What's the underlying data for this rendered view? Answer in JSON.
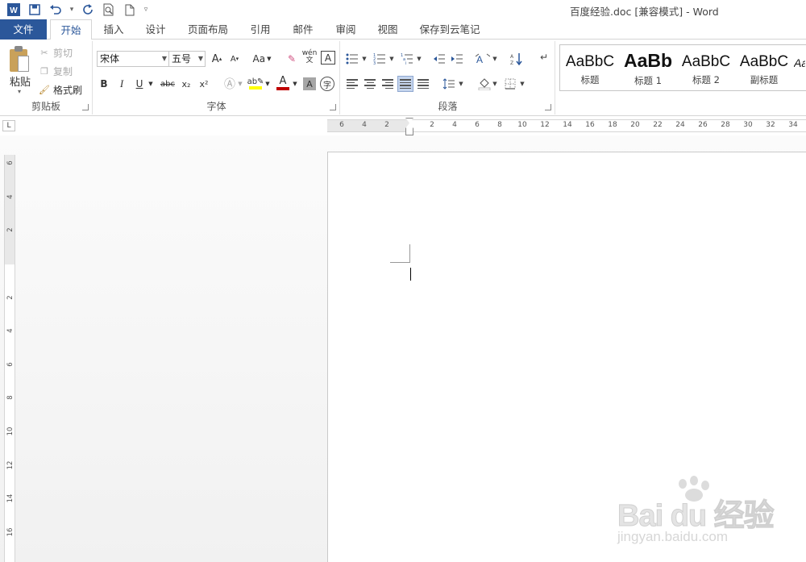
{
  "window": {
    "title": "百度经验.doc [兼容模式] - Word"
  },
  "quick_access": {
    "icons": [
      "word-logo-icon",
      "save-icon",
      "undo-icon",
      "redo-icon",
      "print-preview-icon",
      "new-document-icon",
      "customize-icon"
    ]
  },
  "tabs": [
    {
      "label": "文件",
      "kind": "file"
    },
    {
      "label": "开始",
      "active": true
    },
    {
      "label": "插入"
    },
    {
      "label": "设计"
    },
    {
      "label": "页面布局"
    },
    {
      "label": "引用"
    },
    {
      "label": "邮件"
    },
    {
      "label": "审阅"
    },
    {
      "label": "视图"
    },
    {
      "label": "保存到云笔记"
    }
  ],
  "clipboard": {
    "paste_label": "粘贴",
    "cut_label": "剪切",
    "copy_label": "复制",
    "format_painter_label": "格式刷",
    "group_label": "剪贴板"
  },
  "font": {
    "font_name": "宋体",
    "font_size": "五号",
    "grow_label": "A",
    "shrink_label": "A",
    "case_label": "Aa",
    "phonetic_label": "wén",
    "bold_label": "B",
    "italic_label": "I",
    "underline_label": "U",
    "strike_label": "abc",
    "subscript_label": "x₂",
    "superscript_label": "x²",
    "char_shading_label": "A",
    "enclose_label": "字",
    "group_label": "字体",
    "colors": {
      "highlight": "#ffff00",
      "font_color": "#c00000"
    }
  },
  "paragraph": {
    "group_label": "段落"
  },
  "styles": [
    {
      "sample": "AaBbC",
      "name": "标题"
    },
    {
      "sample": "AaBb",
      "name": "标题 1"
    },
    {
      "sample": "AaBbC",
      "name": "标题 2"
    },
    {
      "sample": "AaBbC",
      "name": "副标题"
    }
  ],
  "ruler": {
    "corner": "L",
    "h_ticks": [
      "6",
      "4",
      "2",
      "2",
      "4",
      "6",
      "8",
      "10",
      "12",
      "14",
      "16",
      "18",
      "20",
      "22",
      "24",
      "26",
      "28",
      "30",
      "32",
      "34"
    ],
    "v_ticks": [
      "6",
      "4",
      "2",
      "2",
      "4",
      "6",
      "8",
      "10",
      "12",
      "14",
      "16"
    ]
  },
  "watermark": {
    "main": "Bai du 经验",
    "url": "jingyan.baidu.com"
  },
  "colors": {
    "accent": "#2b579a"
  }
}
